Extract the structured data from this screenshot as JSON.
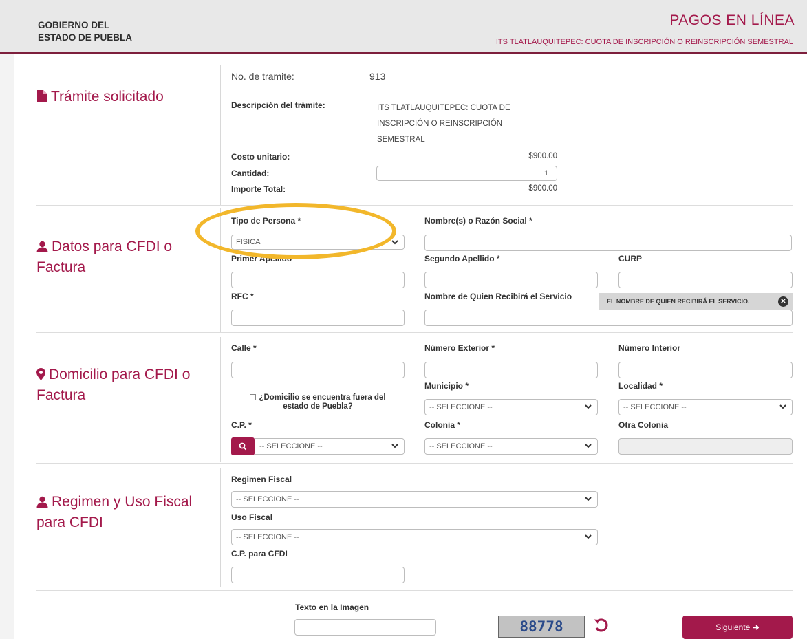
{
  "header": {
    "gov_line1": "GOBIERNO DEL",
    "gov_line2": "ESTADO DE PUEBLA",
    "title": "PAGOS EN LÍNEA",
    "subtitle": "ITS TLATLAUQUITEPEC: CUOTA DE INSCRIPCIÓN O REINSCRIPCIÓN SEMESTRAL"
  },
  "tramite": {
    "section_title": "Trámite solicitado",
    "no_label": "No. de tramite:",
    "no_value": "913",
    "desc_label": "Descripción del trámite:",
    "desc_line1": "ITS TLATLAUQUITEPEC: CUOTA DE",
    "desc_line2": "INSCRIPCIÓN O REINSCRIPCIÓN",
    "desc_line3": "SEMESTRAL",
    "costo_label": "Costo unitario:",
    "costo_value": "$900.00",
    "cantidad_label": "Cantidad:",
    "cantidad_value": "1",
    "importe_label": "Importe Total:",
    "importe_value": "$900.00"
  },
  "cfdi": {
    "section_title_line1": "Datos para CFDI o",
    "section_title_line2": "Factura",
    "tipo_label": "Tipo de Persona *",
    "tipo_value": "FISICA",
    "nombre_label": "Nombre(s) o Razón Social *",
    "primer_label": "Primer Apellido *",
    "segundo_label": "Segundo Apellido *",
    "curp_label": "CURP",
    "rfc_label": "RFC *",
    "recibe_label": "Nombre de Quien Recibirá el Servicio",
    "tooltip": "EL NOMBRE DE QUIEN RECIBIRÁ EL SERVICIO."
  },
  "domicilio": {
    "section_title_line1": "Domicilio para CFDI o",
    "section_title_line2": "Factura",
    "calle_label": "Calle *",
    "num_ext_label": "Número Exterior *",
    "num_int_label": "Número Interior",
    "fuera_line1": "¿Domicilio se encuentra fuera del",
    "fuera_line2": "estado de Puebla?",
    "municipio_label": "Municipio *",
    "municipio_value": "-- SELECCIONE --",
    "localidad_label": "Localidad *",
    "localidad_value": "-- SELECCIONE --",
    "cp_label": "C.P. *",
    "cp_value": "-- SELECCIONE --",
    "colonia_label": "Colonia *",
    "colonia_value": "-- SELECCIONE --",
    "otra_label": "Otra Colonia"
  },
  "regimen": {
    "section_title_line1": "Regimen y Uso Fiscal",
    "section_title_line2": "para CFDI",
    "regimen_label": "Regimen Fiscal",
    "regimen_value": "-- SELECCIONE --",
    "uso_label": "Uso Fiscal",
    "uso_value": "-- SELECCIONE --",
    "cp_cfdi_label": "C.P. para CFDI"
  },
  "footer": {
    "captcha_label": "Texto en la Imagen",
    "captcha_value": "88778",
    "next_label": "Siguiente"
  },
  "colors": {
    "accent": "#a3194b",
    "highlight": "#f2b72b"
  }
}
